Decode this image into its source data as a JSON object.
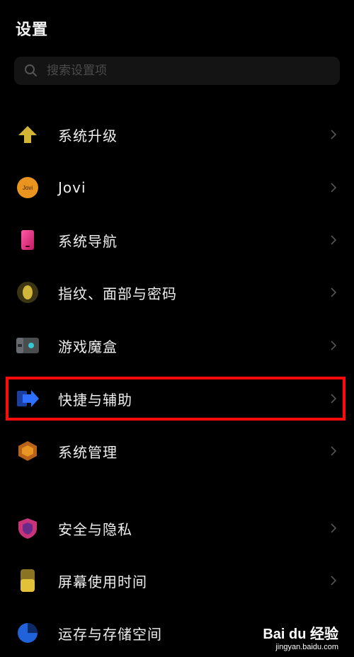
{
  "header": {
    "title": "设置"
  },
  "search": {
    "placeholder": "搜索设置项"
  },
  "items": [
    {
      "label": "系统升级",
      "icon": "system-update-icon"
    },
    {
      "label": "Jovi",
      "icon": "jovi-icon",
      "badge": "Jovi"
    },
    {
      "label": "系统导航",
      "icon": "system-navigation-icon"
    },
    {
      "label": "指纹、面部与密码",
      "icon": "fingerprint-icon"
    },
    {
      "label": "游戏魔盒",
      "icon": "game-box-icon"
    },
    {
      "label": "快捷与辅助",
      "icon": "shortcut-assist-icon"
    },
    {
      "label": "系统管理",
      "icon": "system-management-icon"
    },
    {
      "label": "安全与隐私",
      "icon": "security-privacy-icon"
    },
    {
      "label": "屏幕使用时间",
      "icon": "screen-time-icon"
    },
    {
      "label": "运存与存储空间",
      "icon": "storage-icon"
    }
  ],
  "watermark": {
    "brand": "Bai du 经验",
    "url": "jingyan.baidu.com"
  },
  "colors": {
    "background": "#000000",
    "highlight": "#ff0a0a",
    "chevron": "#555555"
  }
}
